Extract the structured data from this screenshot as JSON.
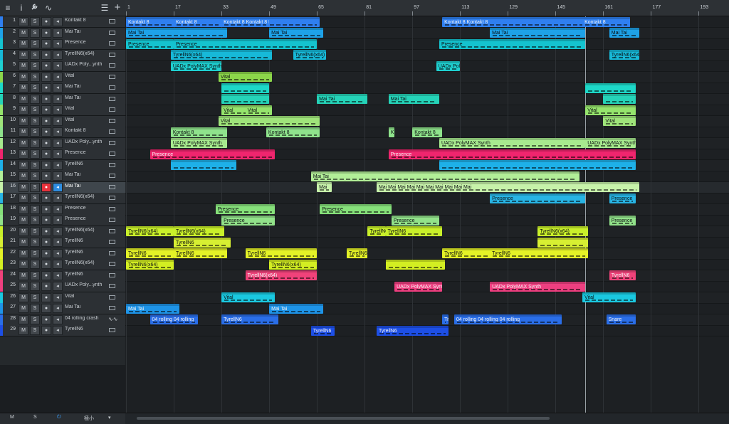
{
  "toolbar": {
    "icons": [
      "menu-icon",
      "info-icon",
      "wrench-icon",
      "automation-icon",
      "list-icon",
      "add-icon"
    ],
    "glyphs": [
      "≡",
      "i",
      "🔧",
      "∿",
      "☰",
      "+"
    ]
  },
  "track_buttons": {
    "mute": "M",
    "solo": "S",
    "record": "●",
    "monitor": "◂"
  },
  "tracks": [
    {
      "num": "1",
      "name": "Kontakt 8",
      "color": "#2f7ff0",
      "type": "inst"
    },
    {
      "num": "2",
      "name": "Mai Tai",
      "color": "#1ea2e8",
      "type": "inst"
    },
    {
      "num": "3",
      "name": "Presence",
      "color": "#14c3cf",
      "type": "inst"
    },
    {
      "num": "4",
      "name": "TyrellN6(x64)",
      "color": "#17b9d8",
      "type": "inst"
    },
    {
      "num": "5",
      "name": "UADx Poly...ynth",
      "color": "#1fd0d0",
      "type": "inst"
    },
    {
      "num": "6",
      "name": "Vital",
      "color": "#8cd64a",
      "type": "inst"
    },
    {
      "num": "7",
      "name": "Mai Tai",
      "color": "#1dd8c8",
      "type": "inst"
    },
    {
      "num": "8",
      "name": "Mai Tai",
      "color": "#25d3b8",
      "type": "inst"
    },
    {
      "num": "9",
      "name": "Vital",
      "color": "#95e46c",
      "type": "inst"
    },
    {
      "num": "10",
      "name": "Vital",
      "color": "#9fe47a",
      "type": "inst"
    },
    {
      "num": "11",
      "name": "Kontakt 8",
      "color": "#8fe38c",
      "type": "inst"
    },
    {
      "num": "12",
      "name": "UADx Poly...ynth",
      "color": "#a7ea8e",
      "type": "inst"
    },
    {
      "num": "13",
      "name": "Presence",
      "color": "#f0256e",
      "type": "inst"
    },
    {
      "num": "14",
      "name": "TyrellN6",
      "color": "#1eb0e8",
      "type": "inst"
    },
    {
      "num": "15",
      "name": "Mai Tai",
      "color": "#b2ee98",
      "type": "inst"
    },
    {
      "num": "16",
      "name": "Mai Tai",
      "color": "#c7f2aa",
      "type": "inst",
      "selected": true
    },
    {
      "num": "17",
      "name": "TyrellN6(x64)",
      "color": "#28b4e4",
      "type": "inst"
    },
    {
      "num": "18",
      "name": "Presence",
      "color": "#86e07a",
      "type": "inst"
    },
    {
      "num": "19",
      "name": "Presence",
      "color": "#92e28a",
      "type": "inst"
    },
    {
      "num": "20",
      "name": "TyrellN6(x64)",
      "color": "#c9f02a",
      "type": "inst"
    },
    {
      "num": "21",
      "name": "TyrellN6",
      "color": "#d7ef32",
      "type": "inst"
    },
    {
      "num": "22",
      "name": "TyrellN6",
      "color": "#e4f227",
      "type": "inst"
    },
    {
      "num": "23",
      "name": "TyrellN6(x64)",
      "color": "#d3ee22",
      "type": "inst"
    },
    {
      "num": "24",
      "name": "TyrellN6",
      "color": "#f0427a",
      "type": "inst"
    },
    {
      "num": "25",
      "name": "UADx Poly...ynth",
      "color": "#ee3f80",
      "type": "inst"
    },
    {
      "num": "26",
      "name": "Vital",
      "color": "#1ac8e0",
      "type": "inst"
    },
    {
      "num": "27",
      "name": "Mai Tai",
      "color": "#1e94e8",
      "type": "inst"
    },
    {
      "num": "28",
      "name": "04 rolling crash",
      "color": "#2a6ee8",
      "type": "audio"
    },
    {
      "num": "29",
      "name": "TyrellN6",
      "color": "#1d4fe6",
      "type": "inst"
    }
  ],
  "bottom": {
    "m": "M",
    "s": "S",
    "power": "⏻",
    "zoom": "極小",
    "zoom_caret": "▾"
  },
  "ruler": {
    "bars": [
      "1",
      "17",
      "33",
      "49",
      "65",
      "81",
      "97",
      "113",
      "129",
      "145",
      "161",
      "177",
      "193"
    ]
  },
  "clips": [
    {
      "t": 0,
      "s": 1,
      "e": 66,
      "label": "Kontakt 8"
    },
    {
      "t": 0,
      "s": 17,
      "e": 33,
      "label": "Kontakt 8"
    },
    {
      "t": 0,
      "s": 33,
      "e": 49,
      "label": "Kontakt 8 Kontakt 8 Kontakt 8"
    },
    {
      "t": 0,
      "s": 107,
      "e": 170,
      "label": "Kontakt 8 Kontakt 8"
    },
    {
      "t": 0,
      "s": 154,
      "e": 170,
      "label": "Kontakt 8"
    },
    {
      "t": 1,
      "s": 1,
      "e": 35,
      "label": "Mai Tai"
    },
    {
      "t": 1,
      "s": 49,
      "e": 67,
      "label": "Mai Tai"
    },
    {
      "t": 1,
      "s": 123,
      "e": 155,
      "label": "Mai Tai"
    },
    {
      "t": 1,
      "s": 163,
      "e": 173,
      "label": "Mai Tai"
    },
    {
      "t": 2,
      "s": 1,
      "e": 17,
      "label": "Presence"
    },
    {
      "t": 2,
      "s": 17,
      "e": 65,
      "label": "Presence"
    },
    {
      "t": 2,
      "s": 106,
      "e": 155,
      "label": "Presence"
    },
    {
      "t": 3,
      "s": 16,
      "e": 50,
      "label": "TyrellN6(x64)"
    },
    {
      "t": 3,
      "s": 57,
      "e": 68,
      "label": "TyrellN6(x64)"
    },
    {
      "t": 3,
      "s": 163,
      "e": 173,
      "label": "TyrellN6(x64)"
    },
    {
      "t": 4,
      "s": 16,
      "e": 33,
      "label": "UADx PolyMAX Synth"
    },
    {
      "t": 4,
      "s": 105,
      "e": 113,
      "label": "UADx Pol"
    },
    {
      "t": 5,
      "s": 32,
      "e": 50,
      "label": "Vital"
    },
    {
      "t": 6,
      "s": 33,
      "e": 49,
      "label": ""
    },
    {
      "t": 6,
      "s": 155,
      "e": 172,
      "label": ""
    },
    {
      "t": 7,
      "s": 33,
      "e": 49,
      "label": ""
    },
    {
      "t": 7,
      "s": 65,
      "e": 82,
      "label": "Mai Tai"
    },
    {
      "t": 7,
      "s": 89,
      "e": 106,
      "label": "Mai Tai"
    },
    {
      "t": 7,
      "s": 161,
      "e": 172,
      "label": ""
    },
    {
      "t": 8,
      "s": 33,
      "e": 42,
      "label": "Vital"
    },
    {
      "t": 8,
      "s": 41,
      "e": 50,
      "label": "Vital"
    },
    {
      "t": 8,
      "s": 155,
      "e": 172,
      "label": "Vital"
    },
    {
      "t": 9,
      "s": 32,
      "e": 66,
      "label": "Vital"
    },
    {
      "t": 9,
      "s": 161,
      "e": 172,
      "label": "Vital"
    },
    {
      "t": 10,
      "s": 16,
      "e": 35,
      "label": "Kontakt 8"
    },
    {
      "t": 10,
      "s": 48,
      "e": 66,
      "label": "Kontakt 8"
    },
    {
      "t": 10,
      "s": 89,
      "e": 91,
      "label": "K"
    },
    {
      "t": 10,
      "s": 97,
      "e": 107,
      "label": "Kontakt 8"
    },
    {
      "t": 11,
      "s": 16,
      "e": 35,
      "label": "UADx PolyMAX Synth"
    },
    {
      "t": 11,
      "s": 106,
      "e": 155,
      "label": "UADx PolyMAX Synth"
    },
    {
      "t": 11,
      "s": 155,
      "e": 172,
      "label": "UADx PolyMAX Synth"
    },
    {
      "t": 12,
      "s": 9,
      "e": 51,
      "label": "Presence"
    },
    {
      "t": 12,
      "s": 89,
      "e": 172,
      "label": "Presence"
    },
    {
      "t": 13,
      "s": 16,
      "e": 38,
      "label": ""
    },
    {
      "t": 13,
      "s": 106,
      "e": 172,
      "label": ""
    },
    {
      "t": 14,
      "s": 63,
      "e": 153,
      "label": "Mai Tai"
    },
    {
      "t": 15,
      "s": 65,
      "e": 70,
      "label": "Mai"
    },
    {
      "t": 15,
      "s": 85,
      "e": 173,
      "label": "Mai Mai Mai Mai Mai Mai Mai Mai Mai Mai"
    },
    {
      "t": 16,
      "s": 123,
      "e": 155,
      "label": "Presence"
    },
    {
      "t": 16,
      "s": 163,
      "e": 172,
      "label": "Presence"
    },
    {
      "t": 17,
      "s": 31,
      "e": 51,
      "label": "Presence"
    },
    {
      "t": 17,
      "s": 66,
      "e": 90,
      "label": "Presence"
    },
    {
      "t": 18,
      "s": 33,
      "e": 51,
      "label": "Presence"
    },
    {
      "t": 18,
      "s": 90,
      "e": 106,
      "label": "Presence"
    },
    {
      "t": 18,
      "s": 163,
      "e": 172,
      "label": "Presence"
    },
    {
      "t": 19,
      "s": 1,
      "e": 17,
      "label": "TyrellN6(x64)"
    },
    {
      "t": 19,
      "s": 17,
      "e": 34,
      "label": "TyrellN6(x64)"
    },
    {
      "t": 19,
      "s": 82,
      "e": 88,
      "label": "TyrellN6"
    },
    {
      "t": 19,
      "s": 88,
      "e": 107,
      "label": "TyrellN6"
    },
    {
      "t": 19,
      "s": 139,
      "e": 156,
      "label": "TyrellN6(x64)"
    },
    {
      "t": 20,
      "s": 17,
      "e": 36,
      "label": "TyrellN6"
    },
    {
      "t": 20,
      "s": 139,
      "e": 156,
      "label": ""
    },
    {
      "t": 21,
      "s": 1,
      "e": 17,
      "label": "TyrellN6"
    },
    {
      "t": 21,
      "s": 17,
      "e": 35,
      "label": "TyrellN6"
    },
    {
      "t": 21,
      "s": 41,
      "e": 65,
      "label": "TyrellN6"
    },
    {
      "t": 21,
      "s": 75,
      "e": 82,
      "label": "TyrellN6"
    },
    {
      "t": 21,
      "s": 107,
      "e": 124,
      "label": "TyrellN6"
    },
    {
      "t": 21,
      "s": 123,
      "e": 156,
      "label": "TyrellN6"
    },
    {
      "t": 22,
      "s": 1,
      "e": 17,
      "label": "TyrellN6(x64)"
    },
    {
      "t": 22,
      "s": 49,
      "e": 65,
      "label": "TyrellN6(x64)"
    },
    {
      "t": 22,
      "s": 88,
      "e": 108,
      "label": ""
    },
    {
      "t": 23,
      "s": 41,
      "e": 65,
      "label": "TyrellN6(x64)"
    },
    {
      "t": 23,
      "s": 163,
      "e": 172,
      "label": "TyrellN6"
    },
    {
      "t": 24,
      "s": 91,
      "e": 107,
      "label": "UADx PolyMAX Synth"
    },
    {
      "t": 24,
      "s": 123,
      "e": 155,
      "label": "UADx PolyMAX Synth"
    },
    {
      "t": 25,
      "s": 33,
      "e": 51,
      "label": "Vital"
    },
    {
      "t": 25,
      "s": 154,
      "e": 172,
      "label": "Vital"
    },
    {
      "t": 26,
      "s": 1,
      "e": 19,
      "label": "Mai Tai"
    },
    {
      "t": 26,
      "s": 49,
      "e": 67,
      "label": "Mai Tai"
    },
    {
      "t": 27,
      "s": 9,
      "e": 25,
      "label": "04 rolling 04 rolling"
    },
    {
      "t": 27,
      "s": 33,
      "e": 52,
      "label": "TyrellN6"
    },
    {
      "t": 27,
      "s": 107,
      "e": 109,
      "label": "Tr"
    },
    {
      "t": 27,
      "s": 111,
      "e": 147,
      "label": "04 rolling 04 rolling 04 rolling"
    },
    {
      "t": 27,
      "s": 162,
      "e": 172,
      "label": "Snare"
    },
    {
      "t": 28,
      "s": 63,
      "e": 71,
      "label": "TyrellN6"
    },
    {
      "t": 28,
      "s": 85,
      "e": 109,
      "label": "TyrellN6"
    }
  ]
}
